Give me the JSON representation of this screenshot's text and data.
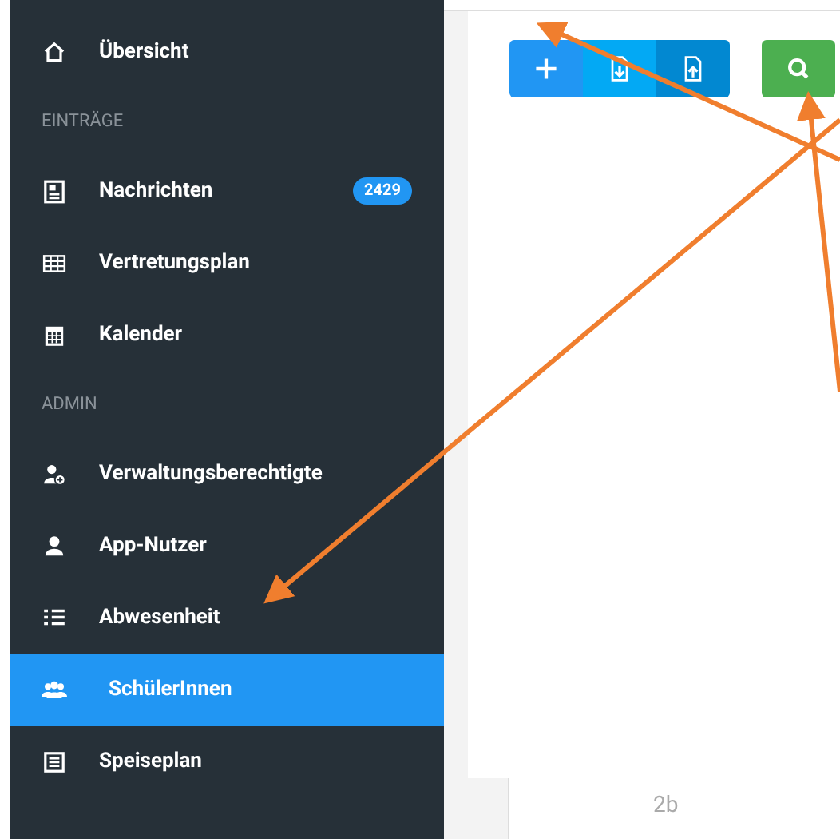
{
  "sidebar": {
    "sections": [
      {
        "items": [
          {
            "label": "Übersicht",
            "selected": false
          }
        ]
      },
      {
        "heading": "EINTRÄGE",
        "items": [
          {
            "label": "Nachrichten",
            "selected": false,
            "badge": "2429"
          },
          {
            "label": "Vertretungsplan",
            "selected": false
          },
          {
            "label": "Kalender",
            "selected": false
          }
        ]
      },
      {
        "heading": "ADMIN",
        "items": [
          {
            "label": "Verwaltungsberechtigte",
            "selected": false
          },
          {
            "label": "App-Nutzer",
            "selected": false
          },
          {
            "label": "Abwesenheit",
            "selected": false
          },
          {
            "label": "SchülerInnen",
            "selected": true
          },
          {
            "label": "Speiseplan",
            "selected": false
          }
        ]
      }
    ]
  },
  "content": {
    "table_cell": "2b"
  }
}
